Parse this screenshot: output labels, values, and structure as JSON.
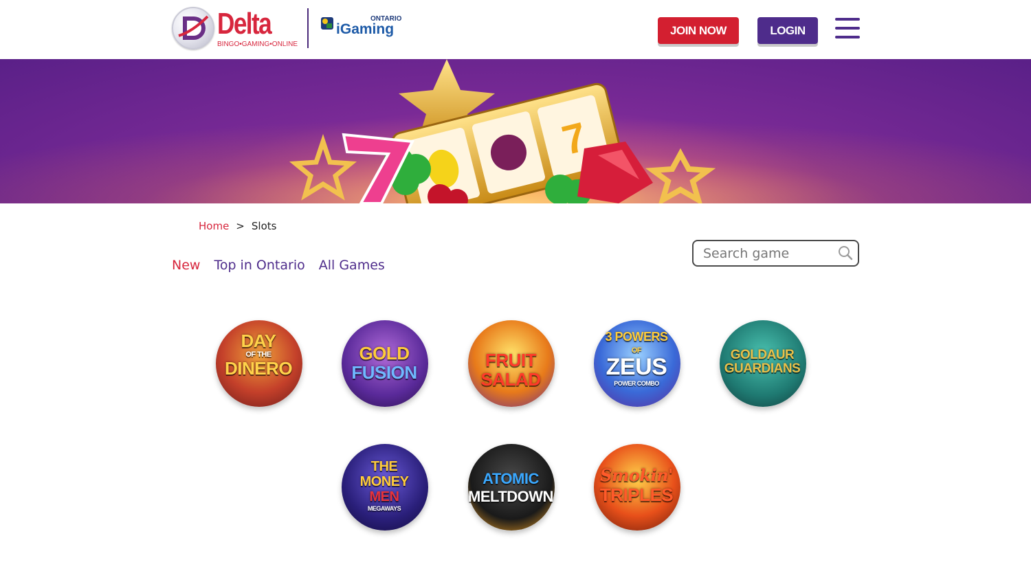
{
  "header": {
    "logo_word": "Delta",
    "logo_sub": "BINGO•GAMING•ONLINE",
    "igaming_ontario": "ONTARIO",
    "igaming_word": "iGaming",
    "join_label": "JOIN NOW",
    "login_label": "LOGIN"
  },
  "breadcrumb": {
    "home": "Home",
    "separator": ">",
    "current": "Slots"
  },
  "tabs": [
    {
      "label": "New",
      "active": true
    },
    {
      "label": "Top in Ontario",
      "active": false
    },
    {
      "label": "All Games",
      "active": false
    }
  ],
  "search": {
    "placeholder": "Search game"
  },
  "games": [
    {
      "line1": "DAY",
      "line2": "OF THE",
      "line3": "DINERO"
    },
    {
      "line1": "GOLD",
      "line2": "",
      "line3": "FUSION"
    },
    {
      "line1": "FRUIT",
      "line2": "",
      "line3": "SALAD"
    },
    {
      "line1": "3 POWERS",
      "line2": "OF",
      "line3": "ZEUS",
      "line4": "POWER COMBO"
    },
    {
      "line1": "GOLDAUR",
      "line2": "",
      "line3": "GUARDIANS"
    },
    {
      "line1": "THE",
      "line2": "MONEY",
      "line3": "MEN",
      "line4": "MEGAWAYS"
    },
    {
      "line1": "ATOMIC",
      "line2": "",
      "line3": "MELTDOWN"
    },
    {
      "line1": "Smokin'",
      "line2": "",
      "line3": "TRIPLES"
    }
  ],
  "colors": {
    "brand_red": "#d31f30",
    "brand_purple": "#4e2c8b"
  }
}
